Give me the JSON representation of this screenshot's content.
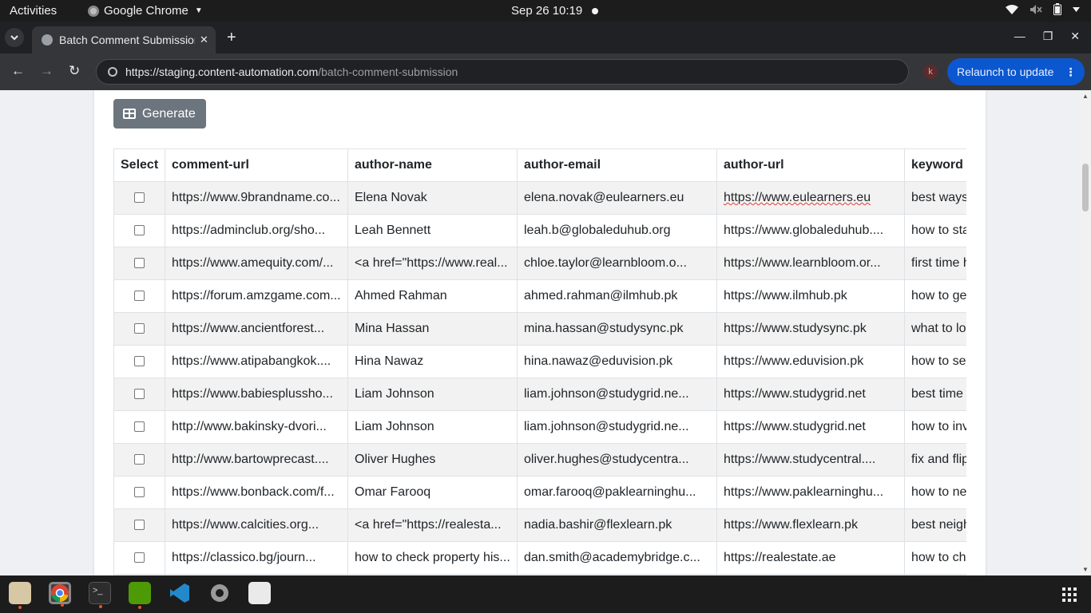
{
  "system": {
    "activities": "Activities",
    "app_name": "Google Chrome",
    "clock": "Sep 26  10:19"
  },
  "browser": {
    "tab_title": "Batch Comment Submission",
    "url_host": "https://staging.content-automation.com",
    "url_path": "/batch-comment-submission",
    "profile_initial": "k",
    "relaunch_label": "Relaunch to update"
  },
  "page": {
    "generate_label": "Generate",
    "columns": [
      "Select",
      "comment-url",
      "author-name",
      "author-email",
      "author-url",
      "keyword"
    ],
    "rows": [
      {
        "comment_url": "https://www.9brandname.co...",
        "author_name": "Elena Novak",
        "author_email": "elena.novak@eulearners.eu",
        "author_url": "https://www.eulearners.eu",
        "keyword": "best ways"
      },
      {
        "comment_url": "https://adminclub.org/sho...",
        "author_name": "Leah Bennett",
        "author_email": "leah.b@globaleduhub.org",
        "author_url": "https://www.globaleduhub....",
        "keyword": "how to sta"
      },
      {
        "comment_url": "https://www.amequity.com/...",
        "author_name": "<a href=\"https://www.real...",
        "author_email": "chloe.taylor@learnbloom.o...",
        "author_url": "https://www.learnbloom.or...",
        "keyword": "first time h"
      },
      {
        "comment_url": "https://forum.amzgame.com...",
        "author_name": "Ahmed Rahman",
        "author_email": "ahmed.rahman@ilmhub.pk",
        "author_url": "https://www.ilmhub.pk",
        "keyword": "how to ge"
      },
      {
        "comment_url": "https://www.ancientforest...",
        "author_name": "Mina Hassan",
        "author_email": "mina.hassan@studysync.pk",
        "author_url": "https://www.studysync.pk",
        "keyword": "what to lo"
      },
      {
        "comment_url": "https://www.atipabangkok....",
        "author_name": "Hina Nawaz",
        "author_email": "hina.nawaz@eduvision.pk",
        "author_url": "https://www.eduvision.pk",
        "keyword": "how to se"
      },
      {
        "comment_url": "https://www.babiesplussho...",
        "author_name": "Liam Johnson",
        "author_email": "liam.johnson@studygrid.ne...",
        "author_url": "https://www.studygrid.net",
        "keyword": "best time"
      },
      {
        "comment_url": "http://www.bakinsky-dvori...",
        "author_name": "Liam Johnson",
        "author_email": "liam.johnson@studygrid.ne...",
        "author_url": "https://www.studygrid.net",
        "keyword": "how to inv"
      },
      {
        "comment_url": "http://www.bartowprecast....",
        "author_name": "Oliver Hughes",
        "author_email": "oliver.hughes@studycentra...",
        "author_url": "https://www.studycentral....",
        "keyword": "fix and flip"
      },
      {
        "comment_url": "https://www.bonback.com/f...",
        "author_name": "Omar Farooq",
        "author_email": "omar.farooq@paklearninghu...",
        "author_url": "https://www.paklearninghu...",
        "keyword": "how to ne"
      },
      {
        "comment_url": "https://www.calcities.org...",
        "author_name": "<a href=\"https://realesta...",
        "author_email": "nadia.bashir@flexlearn.pk",
        "author_url": "https://www.flexlearn.pk",
        "keyword": "best neigh"
      },
      {
        "comment_url": "https://classico.bg/journ...",
        "author_name": "how to check property his...",
        "author_email": "dan.smith@academybridge.c...",
        "author_url": "https://realestate.ae",
        "keyword": "how to ch"
      },
      {
        "comment_url": "",
        "author_name": "",
        "author_email": "",
        "author_url": "",
        "keyword": ""
      }
    ]
  },
  "colors": {
    "relaunch_bg": "#0b57d0",
    "generate_bg": "#6c757d",
    "row_stripe": "#f2f2f2"
  },
  "dock": {
    "apps": [
      "files-icon",
      "chrome-icon",
      "terminal-icon",
      "image-editor-icon",
      "vscode-icon",
      "settings-icon",
      "screenshot-icon"
    ]
  }
}
